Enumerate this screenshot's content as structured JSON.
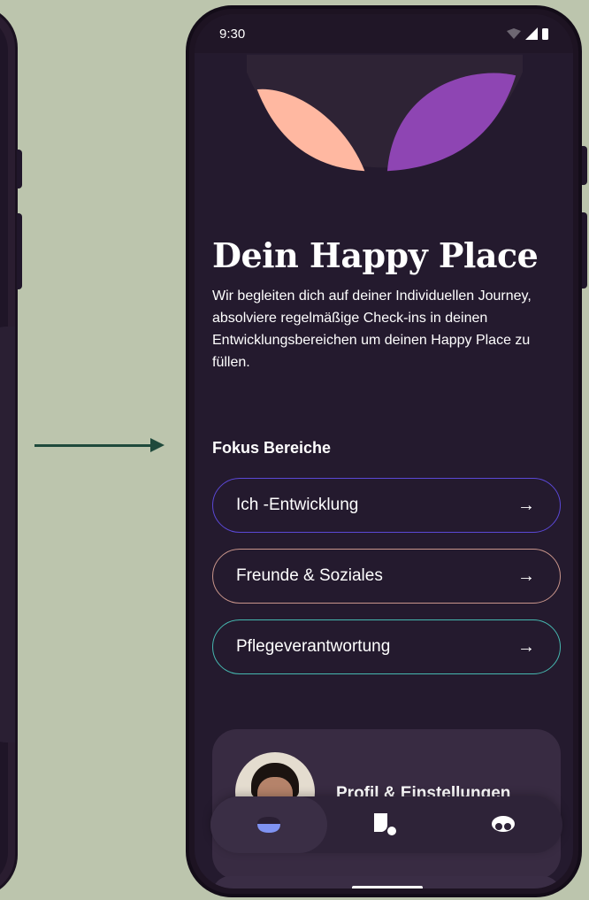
{
  "status_bar": {
    "time": "9:30",
    "icons": [
      "wifi-icon",
      "signal-icon",
      "battery-icon"
    ]
  },
  "hero": {
    "shapes": [
      "peach-leaf",
      "purple-leaf"
    ],
    "colors": {
      "peach": "#ffb8a1",
      "purple": "#8e45b3",
      "dark": "#2e2335"
    }
  },
  "page": {
    "title": "Dein Happy Place",
    "description": "Wir begleiten dich auf deiner Individuellen Journey, absolviere regelmäßige Check-ins in deinen Entwicklungsbereichen um deinen Happy Place zu füllen."
  },
  "focus": {
    "label": "Fokus Bereiche",
    "items": [
      {
        "label": "Ich -Entwicklung",
        "arrow": "→",
        "border_color": "#5b48d6"
      },
      {
        "label": "Freunde & Soziales",
        "arrow": "→",
        "border_color": "#c9958b"
      },
      {
        "label": "Pflegeverantwortung",
        "arrow": "→",
        "border_color": "#46b8b0"
      }
    ]
  },
  "profile": {
    "label": "Profil & Einstellungen"
  },
  "bottom_nav": {
    "items": [
      {
        "icon": "home-icon",
        "active": true
      },
      {
        "icon": "journal-icon",
        "active": false
      },
      {
        "icon": "community-icon",
        "active": false
      }
    ],
    "accent": "#7f93f2"
  },
  "theme": {
    "background": "#bcc5ad",
    "phone_screen": "#241a2e",
    "arrow_color": "#1f4a3c"
  }
}
